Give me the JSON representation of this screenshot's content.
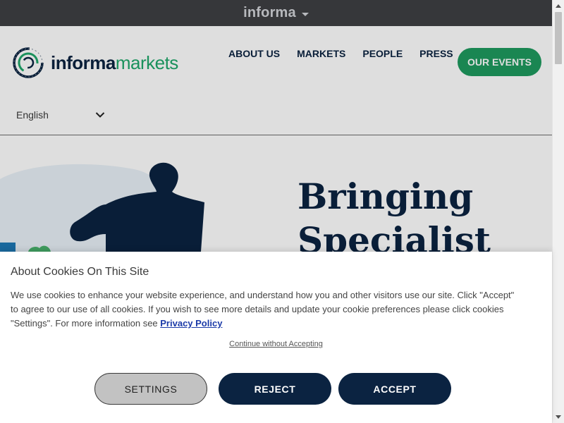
{
  "topbar": {
    "brand": "informa",
    "caret_icon": "caret-down-icon"
  },
  "header": {
    "logo": {
      "word1": "informa",
      "word2": "markets",
      "icon": "informa-rings-logo"
    },
    "nav": [
      {
        "label": "ABOUT US"
      },
      {
        "label": "MARKETS"
      },
      {
        "label": "PEOPLE"
      },
      {
        "label": "PRESS"
      }
    ],
    "events_button": "OUR EVENTS",
    "language": {
      "selected": "English",
      "icon": "chevron-down-icon"
    }
  },
  "hero": {
    "title_line1": "Bringing",
    "title_line2": "Specialist"
  },
  "cookie": {
    "title": "About Cookies On This Site",
    "text": "We use cookies to enhance your website experience, and understand how you and other visitors use our site. Click \"Accept\" to agree to our use of all cookies. If you wish to see more details and update your cookie preferences please click cookies \"Settings\". For more information see ",
    "privacy_link": "Privacy Policy",
    "continue_link": "Continue without Accepting",
    "buttons": {
      "settings": "SETTINGS",
      "reject": "REJECT",
      "accept": "ACCEPT"
    }
  },
  "colors": {
    "navy": "#0b2341",
    "green": "#1e9a5f",
    "topbar": "#36373a",
    "link": "#1b3aa8"
  }
}
